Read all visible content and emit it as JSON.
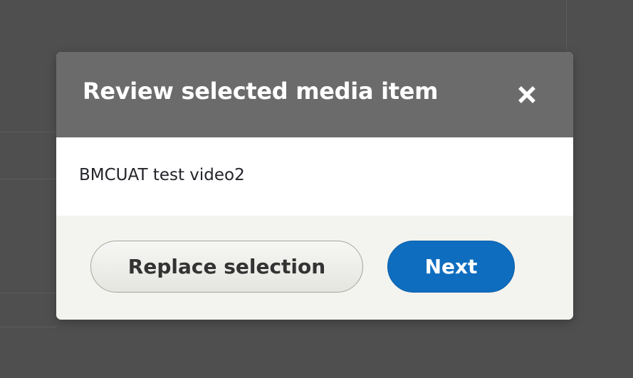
{
  "dialog": {
    "title": "Review selected media item",
    "close_icon": "close-icon",
    "selected_item": "BMCUAT test video2",
    "buttons": {
      "replace_label": "Replace selection",
      "next_label": "Next"
    }
  },
  "colors": {
    "overlay": "#4f4f4f",
    "header_bg": "#6b6b6b",
    "body_bg": "#ffffff",
    "footer_bg": "#f3f3ef",
    "primary_button": "#0f6dbf",
    "secondary_button": "#ecece8",
    "text": "#232429"
  }
}
